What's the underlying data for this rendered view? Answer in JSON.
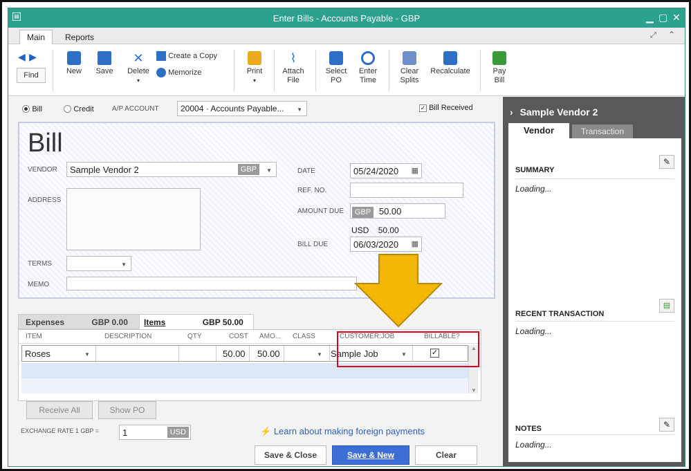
{
  "window": {
    "title": "Enter Bills - Accounts Payable - GBP"
  },
  "menu_tabs": [
    "Main",
    "Reports"
  ],
  "ribbon": {
    "find": "Find",
    "new": "New",
    "save": "Save",
    "delete": "Delete",
    "create_copy": "Create a Copy",
    "memorize": "Memorize",
    "print": "Print",
    "attach_file_1": "Attach",
    "attach_file_2": "File",
    "select_po_1": "Select",
    "select_po_2": "PO",
    "enter_time_1": "Enter",
    "enter_time_2": "Time",
    "clear_splits_1": "Clear",
    "clear_splits_2": "Splits",
    "recalculate": "Recalculate",
    "pay_bill_1": "Pay",
    "pay_bill_2": "Bill"
  },
  "bill_type": {
    "bill": "Bill",
    "credit": "Credit",
    "ap_label": "A/P ACCOUNT",
    "ap_value": "20004 · Accounts Payable...",
    "bill_received": "Bill Received"
  },
  "form": {
    "heading": "Bill",
    "vendor_label": "VENDOR",
    "vendor_value": "Sample Vendor 2",
    "currency": "GBP",
    "address_label": "ADDRESS",
    "terms_label": "TERMS",
    "memo_label": "MEMO",
    "date_label": "DATE",
    "date_value": "05/24/2020",
    "ref_label": "REF. NO.",
    "amount_due_label": "AMOUNT DUE",
    "amount_currency": "GBP",
    "amount_value": "50.00",
    "usd_label": "USD",
    "usd_value": "50.00",
    "bill_due_label": "BILL DUE",
    "bill_due_value": "06/03/2020"
  },
  "detail_tabs": {
    "expenses": "Expenses",
    "expenses_amount": "GBP  0.00",
    "items": "Items",
    "items_amount": "GBP  50.00"
  },
  "columns": [
    "ITEM",
    "DESCRIPTION",
    "QTY",
    "COST",
    "AMO...",
    "CLASS",
    "CUSTOMER:JOB",
    "BILLABLE?"
  ],
  "row": {
    "item": "Roses",
    "description": "",
    "qty": "",
    "cost": "50.00",
    "amount": "50.00",
    "class": "",
    "customer_job": "Sample Job"
  },
  "footer": {
    "receive_all": "Receive All",
    "show_po": "Show PO",
    "exchange_label": "EXCHANGE RATE 1 GBP =",
    "exchange_value": "1",
    "exchange_currency": "USD",
    "learn_link": "Learn about making foreign payments",
    "save_close": "Save & Close",
    "save_new": "Save & New",
    "clear": "Clear"
  },
  "side": {
    "vendor_name": "Sample Vendor 2",
    "tab_vendor": "Vendor",
    "tab_transaction": "Transaction",
    "summary": "SUMMARY",
    "summary_loading": "Loading...",
    "recent": "RECENT TRANSACTION",
    "recent_loading": "Loading...",
    "notes": "NOTES",
    "notes_loading": "Loading..."
  },
  "colors": {
    "titlebar": "#2ca18e",
    "highlight": "#e0001b",
    "arrow": "#f2b705",
    "primary_button": "#3b6fd6"
  }
}
